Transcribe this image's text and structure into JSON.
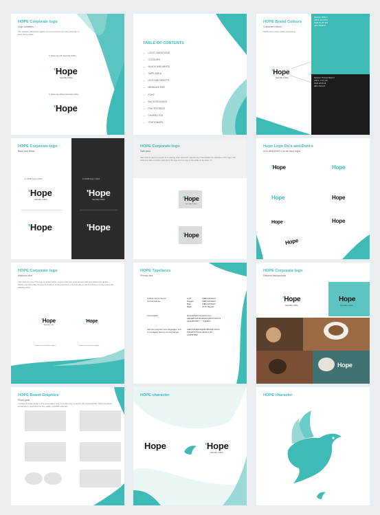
{
  "brand_name": "Hope",
  "brand_tagline": "Specialty Coffee",
  "colors": {
    "teal": "#3ebbb7",
    "teal_light": "#9bd9d6",
    "dark": "#2b2b2b",
    "black": "#1c1c1c",
    "light_grey": "#e8e8e8"
  },
  "pages": {
    "logo_variations": {
      "title": "HOPE Corporate logo",
      "subtitle": "Logo variations",
      "desc": "The variation without the tagline can be used when the size presently of them being legible.",
      "label_with_tagline": "In Hope logo with  Specialty Coffee",
      "label_without_tagline": "In Hope logo without  Specialty Coffee"
    },
    "toc": {
      "title": "TABLE OF CONTENTS",
      "items": [
        "LOGO VARIATIONS",
        "COLOURS",
        "BLACK AND WHITE",
        "SAFE AREA",
        "DO'S AND DON'T'S",
        "MINIMUM SIZE",
        "FONT",
        "BACKGROUNDS",
        "PHOTO GRIDS",
        "CHARACTER",
        "STATIONARY"
      ]
    },
    "brand_colours": {
      "title": "HOPE Brand Colours",
      "subtitle": "Corporate colours",
      "desc": "HOPE uses unique shade of branding",
      "swatch_top_text": [
        "Pantone: 3265 C",
        "CMYK: 65 0 35 0",
        "RGB: 62 187 183",
        "HEX: #3ebbb7"
      ],
      "swatch_bottom_text": [
        "Pantone: Process Black C",
        "CMYK: 0 0 0 100",
        "RGB: 28 28 28",
        "HEX: #1c1c1c"
      ]
    },
    "black_white": {
      "title": "HOPE Corporate logo",
      "subtitle": "Black and White",
      "label_white": "In HOPE logo in white",
      "label_black": "In HOPE logo in black"
    },
    "safe_area": {
      "title": "HOPE Corporate logo",
      "subtitle": "Safe area",
      "desc": "Safe area is used to prevent from placing other elements near the logo that distract the attention of the logo. The minimum safe on bolder sizes from the logo and our logo is the width of the letter \"H\"."
    },
    "dos_donts": {
      "title": "Hope Logo Do's and Dont's",
      "subtitle": "DO's and DONT's for all Hope logos"
    },
    "minimum_size": {
      "title": "HOPE Corporate logo",
      "subtitle": "Minimum size",
      "desc": "The minimum size of the logo is shown below. Logos in this size must be used with and without the tagline. Please note that while the logo is printed in small proportions, it is important to avoid reducing our logo below the following sizes.",
      "label_left": "In minimum size with the tagline",
      "label_right": "In minimum size without tagline"
    },
    "typefaces": {
      "title": "HOPE Typefaces",
      "subtitle": "Primary font",
      "rows": [
        {
          "label": "Gotham font is free for commercial use",
          "name": "Light\nRegular\nBold\nBlack",
          "spec": "AaBbCcDdEeFf\nAaBbCcDdEeFf\nAaBbCcDdEeFf\nLATO Regular"
        },
        {
          "label": "Font weights",
          "name": "",
          "spec": "abcdefghijklmnopqrstuvwxyz\nABCDEFGHIJKLMNOPQRSTUVWXYZ\n0123456789(!?.,:;\"'&@#$%)"
        },
        {
          "label": "Lato font supports more languages, and is completely free for commercial use",
          "name": "",
          "spec": "AaBbCcDdEeFfGgHhIiJjKkLlMmNnOo\nPpQqRrSsTtUuVvWwXxYyZz\n1234567890"
        }
      ]
    },
    "backgrounds": {
      "title": "HOPE Corporate logo",
      "subtitle": "Different backgrounds"
    },
    "photo_grids": {
      "title": "HOPE Brand Graphics",
      "subtitle": "Photo grids",
      "desc": "Consistent image design in the presentation is an important way to express the brand identity. These should be accessible to guarantee the fine quality of HOPE materials."
    },
    "character_1": {
      "title": "HOPE character"
    },
    "character_2": {
      "title": "HOPE character"
    }
  }
}
